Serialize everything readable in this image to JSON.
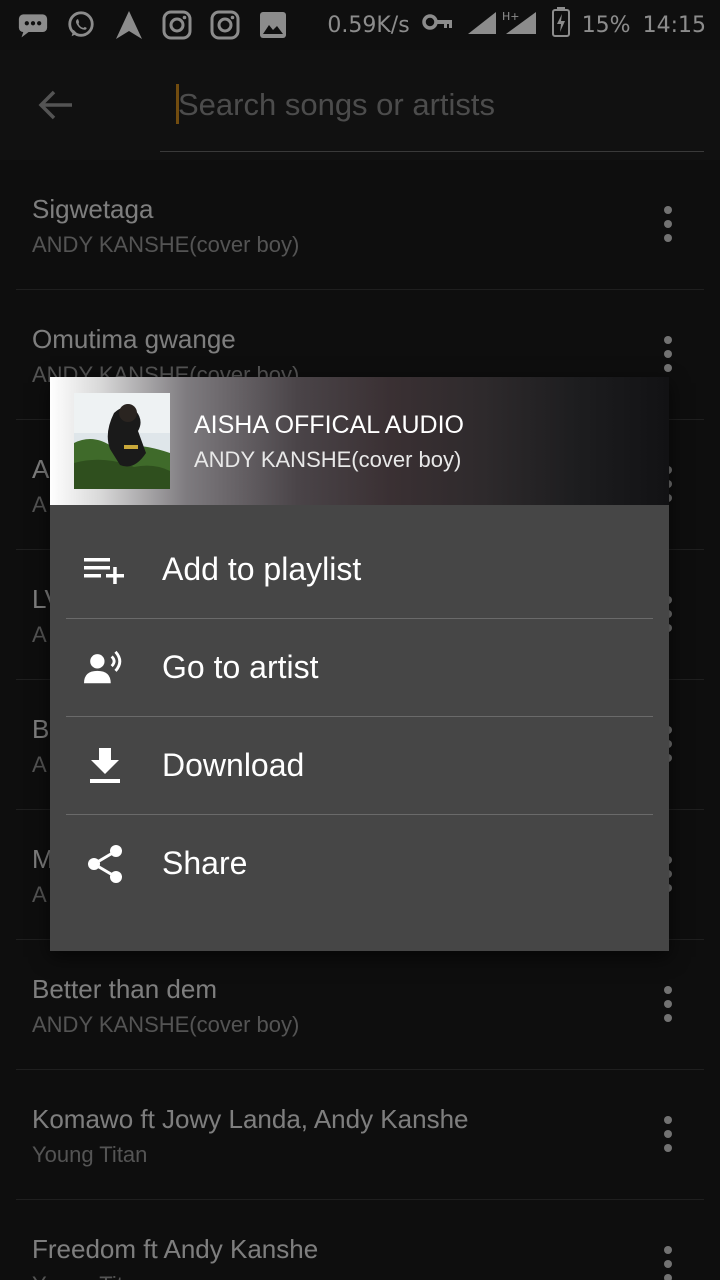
{
  "status_bar": {
    "net_speed": "0.59K/s",
    "battery": "15%",
    "time": "14:15",
    "net_type": "H+",
    "icons": [
      "message-icon",
      "whatsapp-icon",
      "navigation-icon",
      "instagram-icon",
      "instagram-icon",
      "gallery-icon",
      "vpn-key-icon",
      "signal-icon",
      "battery-charging-icon"
    ]
  },
  "app_bar": {
    "search_placeholder": "Search songs or artists"
  },
  "songs": [
    {
      "title": "Sigwetaga",
      "artist": "ANDY KANSHE(cover boy)"
    },
    {
      "title": "Omutima gwange",
      "artist": "ANDY KANSHE(cover boy)"
    },
    {
      "title": "A",
      "artist": "A"
    },
    {
      "title": "LV",
      "artist": "A"
    },
    {
      "title": "B",
      "artist": "A"
    },
    {
      "title": "M",
      "artist": "A"
    },
    {
      "title": "Better than dem",
      "artist": "ANDY KANSHE(cover boy)"
    },
    {
      "title": "Komawo ft Jowy Landa, Andy Kanshe",
      "artist": "Young Titan"
    },
    {
      "title": "Freedom ft Andy Kanshe",
      "artist": "Young Titan"
    }
  ],
  "dialog": {
    "title": "AISHA OFFICAL AUDIO",
    "artist": "ANDY KANSHE(cover boy)",
    "menu": [
      {
        "label": "Add to playlist",
        "icon": "playlist-add-icon"
      },
      {
        "label": "Go to artist",
        "icon": "artist-voice-icon"
      },
      {
        "label": "Download",
        "icon": "download-icon"
      },
      {
        "label": "Share",
        "icon": "share-icon"
      }
    ]
  }
}
